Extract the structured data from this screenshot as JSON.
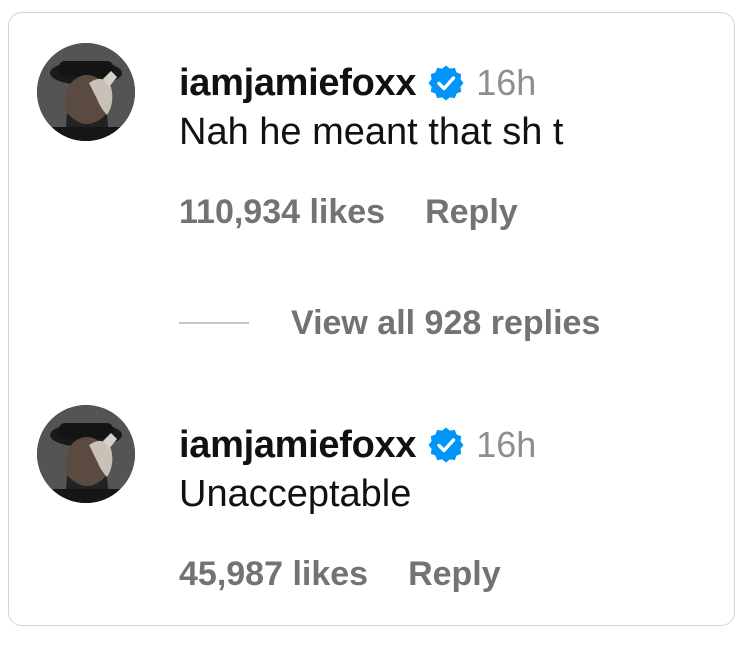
{
  "comments": [
    {
      "username": "iamjamiefoxx",
      "time": "16h",
      "text": "Nah he meant that sh t",
      "likes": "110,934 likes",
      "reply_label": "Reply"
    },
    {
      "username": "iamjamiefoxx",
      "time": "16h",
      "text": "Unacceptable",
      "likes": "45,987 likes",
      "reply_label": "Reply"
    }
  ],
  "view_replies": "View all 928 replies",
  "colors": {
    "verified_blue": "#0095f6",
    "username": "#111111",
    "meta_gray": "#737373",
    "time_gray": "#8e8e8e"
  },
  "icons": {
    "verified": "verified-badge-icon",
    "avatar": "profile-avatar"
  }
}
